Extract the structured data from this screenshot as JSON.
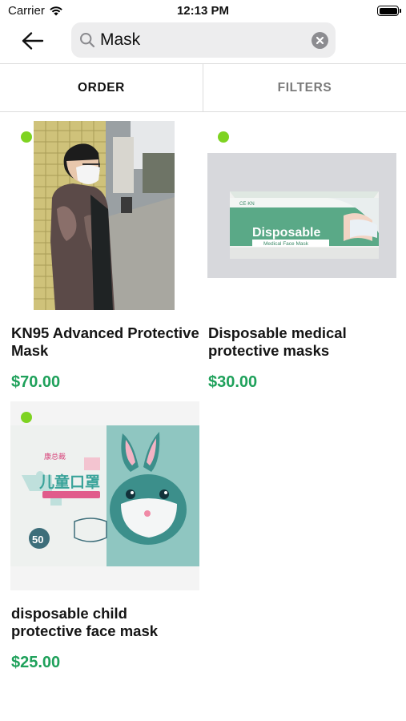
{
  "status_bar": {
    "carrier": "Carrier",
    "time": "12:13 PM"
  },
  "search": {
    "query": "Mask",
    "placeholder": "Search"
  },
  "tabs": {
    "order": "ORDER",
    "filters": "FILTERS"
  },
  "colors": {
    "accent_green": "#1fa15b",
    "availability_dot": "#7ed321"
  },
  "products": [
    {
      "name": "KN95 Advanced Protective Mask",
      "price": "$70.00",
      "in_stock": true
    },
    {
      "name": "Disposable medical protective masks",
      "price": "$30.00",
      "in_stock": true,
      "image_text": {
        "title": "Disposable",
        "subtitle": "Medical Face Mask"
      }
    },
    {
      "name": "disposable child protective face mask",
      "price": "$25.00",
      "in_stock": true,
      "image_text": {
        "brand": "康总裁",
        "title": "儿童口罩",
        "count": "50"
      }
    }
  ]
}
